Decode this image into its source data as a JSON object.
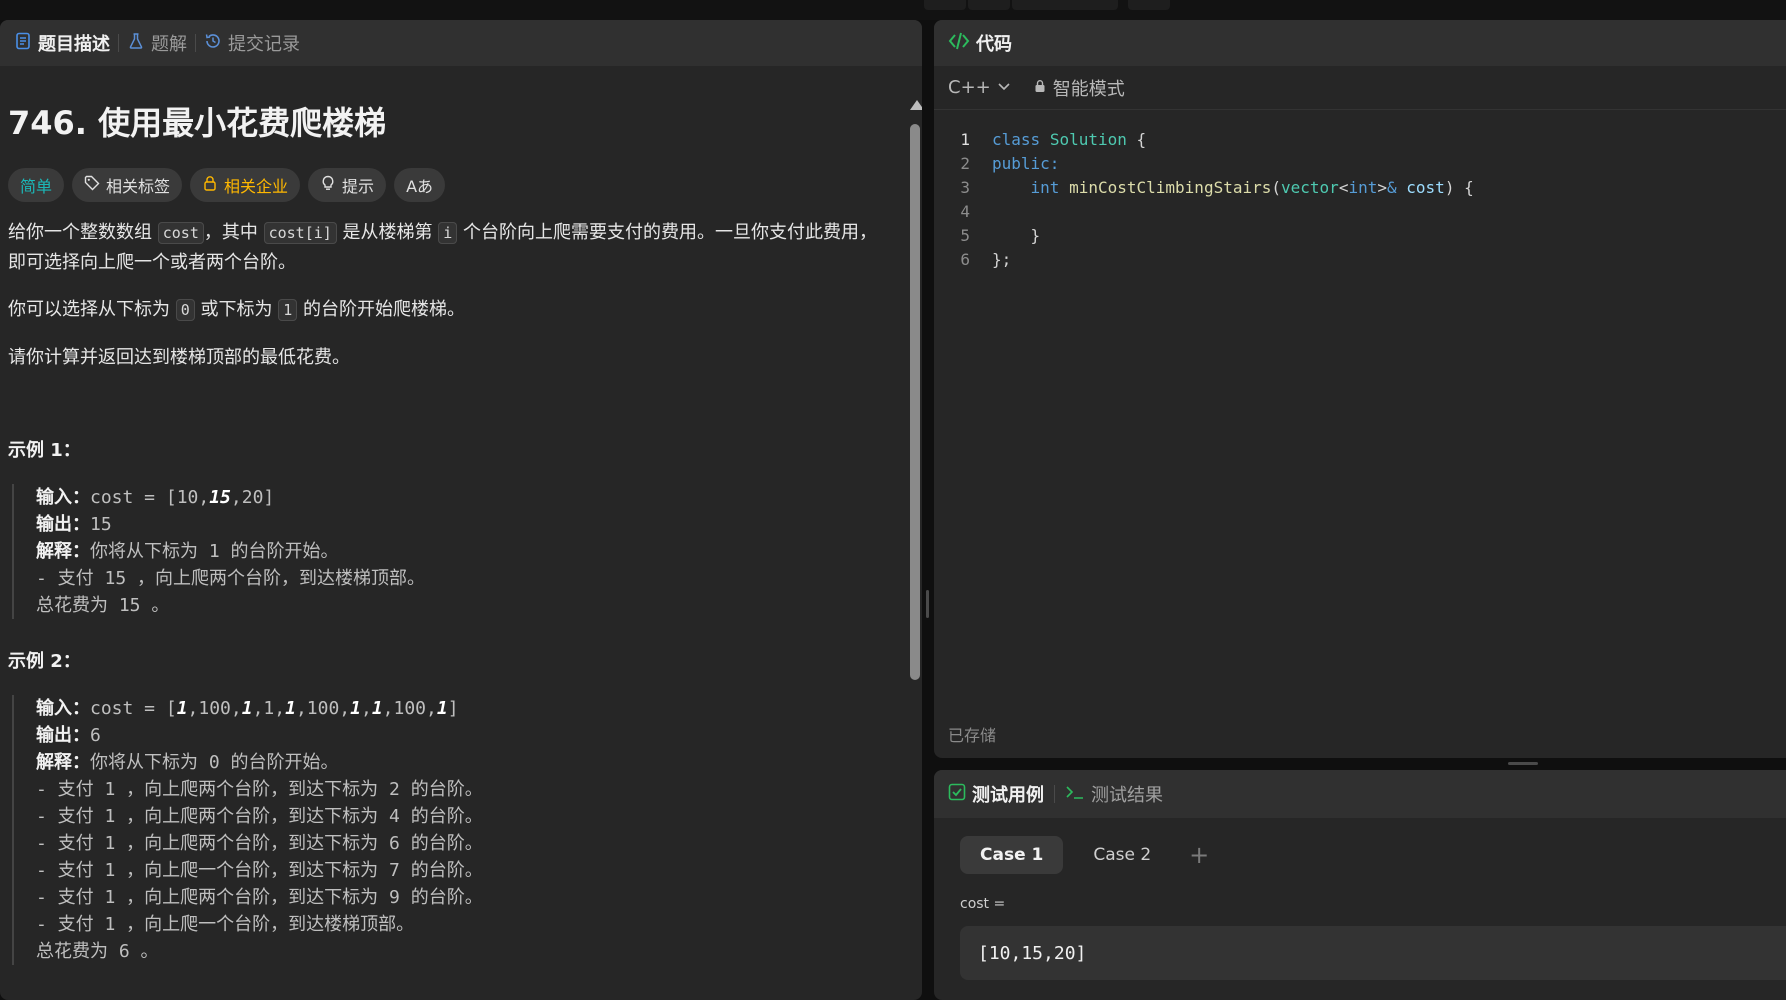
{
  "left_tabs": [
    {
      "label": "题目描述",
      "icon": "description-icon"
    },
    {
      "label": "题解",
      "icon": "flask-icon"
    },
    {
      "label": "提交记录",
      "icon": "history-icon"
    }
  ],
  "problem": {
    "title": "746. 使用最小花费爬楼梯",
    "chips": {
      "difficulty": "简单",
      "tags": "相关标签",
      "companies": "相关企业",
      "hint": "提示",
      "translate": "Aあ"
    },
    "desc1_a": "给你一个整数数组 ",
    "desc1_code1": "cost",
    "desc1_b": "，其中 ",
    "desc1_code2": "cost[i]",
    "desc1_c": " 是从楼梯第 ",
    "desc1_code3": "i",
    "desc1_d": " 个台阶向上爬需要支付的费用。一旦你支付此费用，即可选择向上爬一个或者两个台阶。",
    "desc2_a": "你可以选择从下标为 ",
    "desc2_code1": "0",
    "desc2_b": " 或下标为 ",
    "desc2_code2": "1",
    "desc2_c": " 的台阶开始爬楼梯。",
    "desc3": "请你计算并返回达到楼梯顶部的最低花费。",
    "example1_label": "示例 1：",
    "example2_label": "示例 2：",
    "input_label": "输入：",
    "output_label": "输出：",
    "explain_label": "解释：",
    "ex1_input_pre": "cost = [10,",
    "ex1_input_em": "15",
    "ex1_input_post": ",20]",
    "ex1_output": "15",
    "ex1_explain": "你将从下标为 1 的台阶开始。",
    "ex1_lines": [
      "- 支付 15 ，向上爬两个台阶，到达楼梯顶部。",
      "总花费为 15 。"
    ],
    "ex2_input": [
      "cost = [",
      "1",
      ",100,",
      "1",
      ",1,",
      "1",
      ",100,",
      "1",
      ",",
      "1",
      ",100,",
      "1",
      "]"
    ],
    "ex2_output": "6",
    "ex2_explain": "你将从下标为 0 的台阶开始。",
    "ex2_lines": [
      "- 支付 1 ，向上爬两个台阶，到达下标为 2 的台阶。",
      "- 支付 1 ，向上爬两个台阶，到达下标为 4 的台阶。",
      "- 支付 1 ，向上爬两个台阶，到达下标为 6 的台阶。",
      "- 支付 1 ，向上爬一个台阶，到达下标为 7 的台阶。",
      "- 支付 1 ，向上爬两个台阶，到达下标为 9 的台阶。",
      "- 支付 1 ，向上爬一个台阶，到达楼梯顶部。",
      "总花费为 6 。"
    ]
  },
  "code_panel": {
    "title": "代码",
    "language": "C++",
    "mode": "智能模式",
    "saved": "已存储",
    "line_numbers": [
      "1",
      "2",
      "3",
      "4",
      "5",
      "6"
    ],
    "code": {
      "l1_kw": "class",
      "l1_ty": "Solution",
      "l1_rest": " {",
      "l2_kw": "public:",
      "l3_indent": "    ",
      "l3_kw": "int",
      "l3_fn": "minCostClimbingStairs",
      "l3_p1": "(",
      "l3_ty": "vector",
      "l3_lt": "<",
      "l3_kw2": "int",
      "l3_gt": ">",
      "l3_amp": "&",
      "l3_param": "cost",
      "l3_end": ") {",
      "l5": "    }",
      "l6": "};"
    }
  },
  "test_panel": {
    "tab_cases": "测试用例",
    "tab_results": "测试结果",
    "cases": [
      "Case 1",
      "Case 2"
    ],
    "add_case": "+",
    "var_label": "cost =",
    "var_value": "[10,15,20]"
  },
  "colors": {
    "easy": "#1cb8b8",
    "company": "#ffb800",
    "test_icon": "#2cbb5d",
    "code_icon": "#2cbb5d",
    "tab_blue": "#4a8fe7"
  }
}
